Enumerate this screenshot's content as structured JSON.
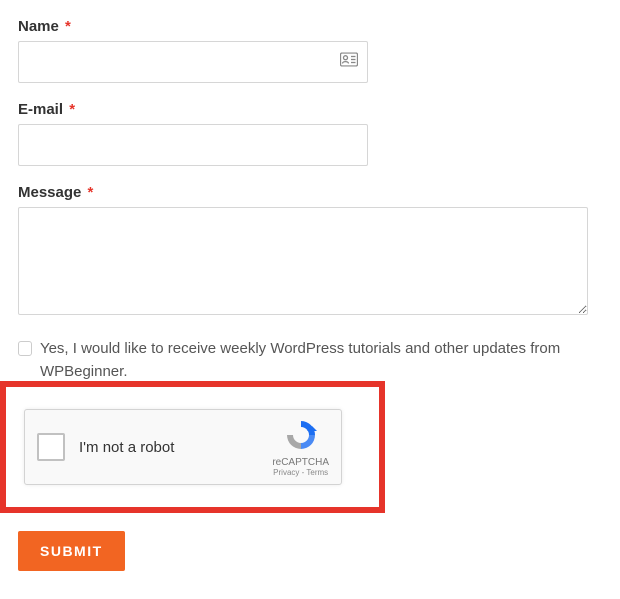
{
  "form": {
    "name": {
      "label": "Name",
      "required": "*",
      "value": ""
    },
    "email": {
      "label": "E-mail",
      "required": "*",
      "value": ""
    },
    "message": {
      "label": "Message",
      "required": "*",
      "value": ""
    },
    "newsletter": {
      "label": "Yes, I would like to receive weekly WordPress tutorials and other updates from WPBeginner."
    },
    "recaptcha": {
      "label": "I'm not a robot",
      "brand": "reCAPTCHA",
      "links": "Privacy - Terms"
    },
    "submit": {
      "label": "SUBMIT"
    }
  },
  "colors": {
    "accent": "#f26522",
    "error": "#e6342a"
  },
  "icons": {
    "contact_card": "contact-card-icon",
    "recaptcha_logo": "recaptcha-logo-icon"
  }
}
